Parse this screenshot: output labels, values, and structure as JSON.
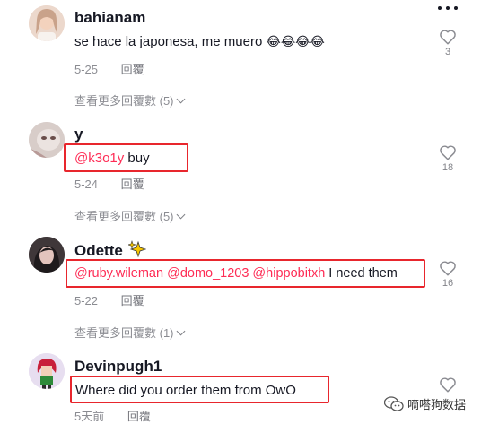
{
  "comments": [
    {
      "username": "bahianam",
      "text": "se hace la japonesa, me muero",
      "emojis": "😂😂😂😂",
      "date": "5-25",
      "reply_label": "回覆",
      "likes": "3",
      "more_replies": "查看更多回覆數 (5)"
    },
    {
      "username": "y",
      "mention": "@k3o1y",
      "text": " buy",
      "date": "5-24",
      "reply_label": "回覆",
      "likes": "18",
      "more_replies": "查看更多回覆數 (5)"
    },
    {
      "username": "Odette",
      "username_emoji": "✨",
      "mentions": "@ruby.wileman @domo_1203 @hippobitxh",
      "text": " I need them",
      "date": "5-22",
      "reply_label": "回覆",
      "likes": "16",
      "more_replies": "查看更多回覆數 (1)"
    },
    {
      "username": "Devinpugh1",
      "text": "Where did you order them from OwO",
      "date": "5天前",
      "reply_label": "回覆"
    }
  ],
  "watermark": {
    "text": "嘀嗒狗数据",
    "icon": "wechat-icon"
  },
  "colors": {
    "mention": "#fe2c55",
    "highlight": "#e8262d",
    "text": "#161823"
  },
  "icons": {
    "like": "heart-outline-icon",
    "menu": "more-dots-icon",
    "expand": "chevron-down-icon"
  }
}
